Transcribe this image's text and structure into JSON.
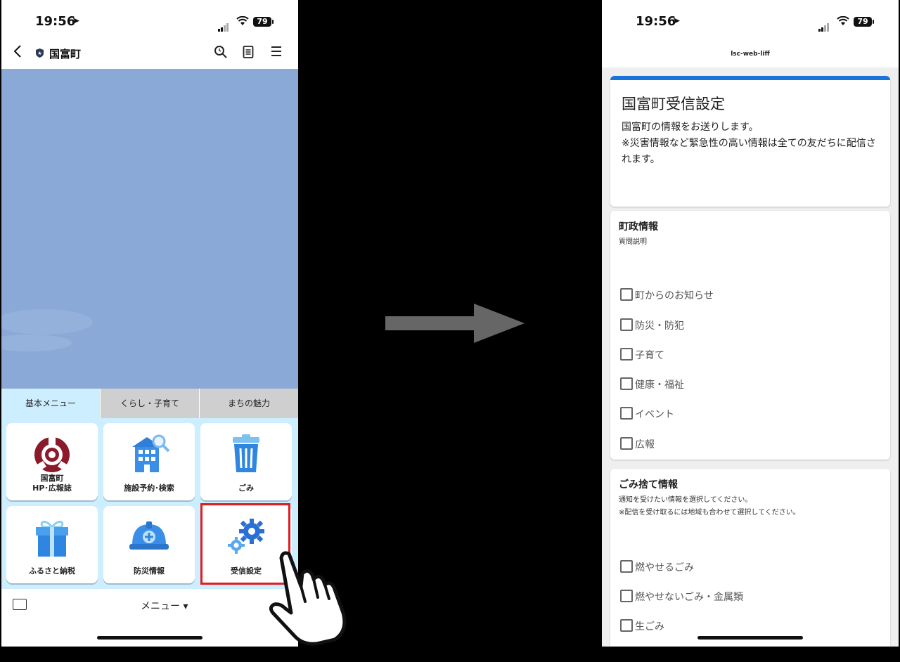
{
  "status_bar": {
    "time": "19:56",
    "battery": "79"
  },
  "left_phone": {
    "header": {
      "title": "国富町"
    },
    "tabs": [
      {
        "label": "基本メニュー"
      },
      {
        "label": "くらし・子育て"
      },
      {
        "label": "まちの魅力"
      }
    ],
    "menu_items": [
      {
        "label": "国富町\nHP･広報誌",
        "icon": "town-emblem-icon"
      },
      {
        "label": "施設予約･検索",
        "icon": "building-search-icon"
      },
      {
        "label": "ごみ",
        "icon": "trash-can-icon"
      },
      {
        "label": "ふるさと納税",
        "icon": "gift-icon"
      },
      {
        "label": "防災情報",
        "icon": "helmet-icon"
      },
      {
        "label": "受信設定",
        "icon": "gears-icon"
      }
    ],
    "footer": {
      "menu_label": "メニュー ▾"
    }
  },
  "right_phone": {
    "header": {
      "url": "lsc-web-liff"
    },
    "form": {
      "title": "国富町受信設定",
      "description": "国富町の情報をお送りします。\n※災害情報など緊急性の高い情報は全ての友だちに配信されます。",
      "sections": [
        {
          "title": "町政情報",
          "description": "質問説明",
          "options": [
            "町からのお知らせ",
            "防災・防犯",
            "子育て",
            "健康・福祉",
            "イベント",
            "広報"
          ]
        },
        {
          "title": "ごみ捨て情報",
          "description": "通知を受けたい情報を選択してください。\n※配信を受け取るには地域も合わせて選択してください。",
          "options": [
            "燃やせるごみ",
            "燃やせないごみ・金属類",
            "生ごみ"
          ]
        }
      ]
    }
  },
  "colors": {
    "highlight": "#e01e1e",
    "accent": "#1a73d9",
    "hero": "#8aa9d6"
  }
}
